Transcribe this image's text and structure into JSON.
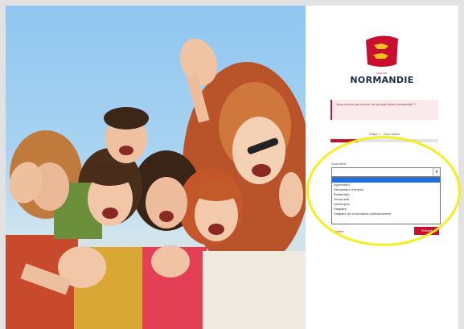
{
  "brand": {
    "name": "NORMANDIE",
    "subtitle": "RÉGION",
    "accent_color": "#c8102e",
    "logo_icon": "normandy-leopards-flag-icon"
  },
  "notice": {
    "text": "Vous n'avez pas encore de compte Atouts Normandie ?"
  },
  "wizard": {
    "step_label": "Étape 1 - Votre statut",
    "progress": 0.25,
    "field_label": "Vous êtes *",
    "selected_value": "",
    "options": [
      "",
      "Apprenti(e)",
      "Demandeur d'emploi",
      "Étudiant(e)",
      "Jeune actif",
      "Lycéen(ne)",
      "Stagiaire",
      "Stagiaire de la formation professionnelle"
    ],
    "highlighted_option_index": 0,
    "back_label": "Annuler",
    "next_label": "Suivant"
  },
  "annotation": {
    "shape": "ellipse",
    "color": "#f4ef1a"
  }
}
